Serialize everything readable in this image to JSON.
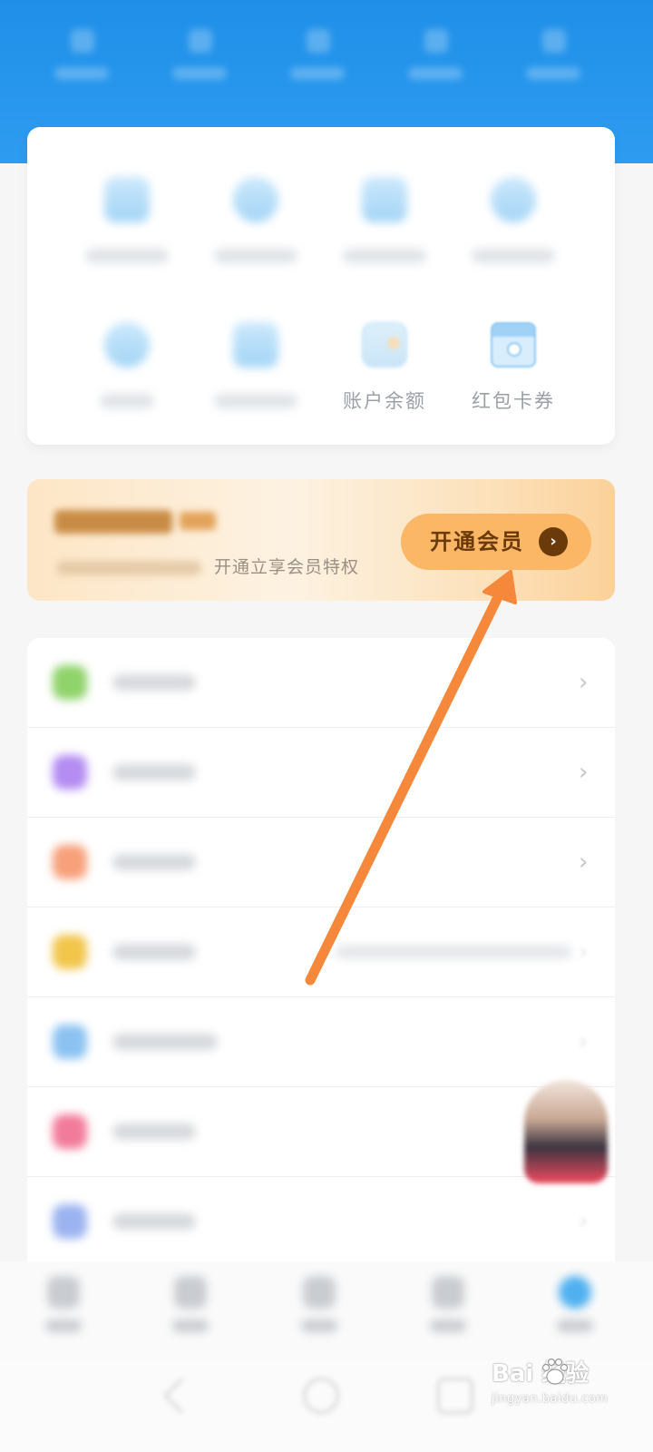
{
  "service_grid": {
    "items": [
      {
        "label": "",
        "icon": "calendar-icon"
      },
      {
        "label": "",
        "icon": "document-icon"
      },
      {
        "label": "",
        "icon": "clipboard-icon"
      },
      {
        "label": "",
        "icon": "cloud-icon"
      },
      {
        "label": "",
        "icon": "person-icon"
      },
      {
        "label": "",
        "icon": "card-icon"
      },
      {
        "label": "账户余额",
        "icon": "wallet-icon"
      },
      {
        "label": "红包卡券",
        "icon": "envelope-icon"
      }
    ]
  },
  "vip_banner": {
    "subtitle": "开通立享会员特权",
    "button_label": "开通会员",
    "button_icon": "chevron-right-icon"
  },
  "settings_list": {
    "items": [
      {
        "icon_color": "#8fd36a"
      },
      {
        "icon_color": "#b48cf2"
      },
      {
        "icon_color": "#f7a07a"
      },
      {
        "icon_color": "#f2c54b"
      },
      {
        "icon_color": "#8cc2f2"
      },
      {
        "icon_color": "#f27a9a"
      },
      {
        "icon_color": "#9bb3f0"
      }
    ]
  },
  "colors": {
    "header_blue": "#1f8fe8",
    "vip_button": "#fbb666",
    "vip_text": "#6b3a0a",
    "annotation_arrow": "#f5883a"
  },
  "watermark": {
    "brand": "Bai 经验",
    "url": "jingyan.baidu.com"
  }
}
